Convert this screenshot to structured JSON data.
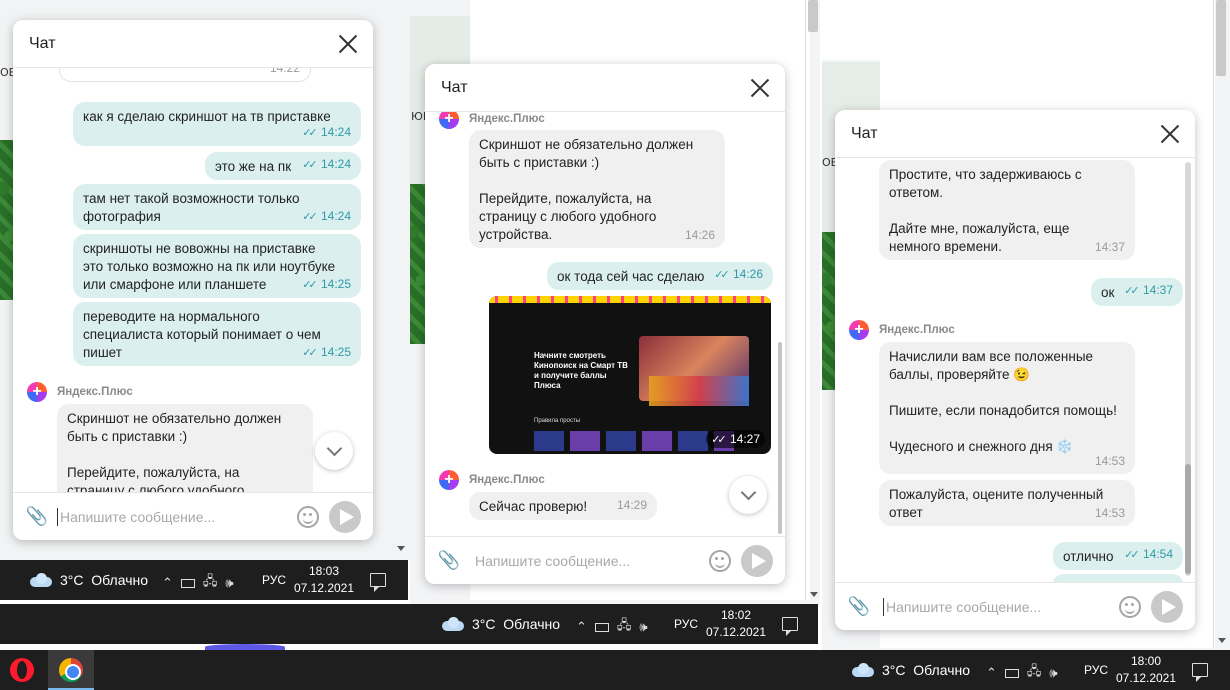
{
  "colors": {
    "outgoing_bubble": "#dcefef",
    "incoming_bubble": "#f0f0f0",
    "read_ticks": "#2c9aa7",
    "taskbar": "#1e1e1e"
  },
  "icons": {
    "close": "close-icon",
    "attach": "paperclip-icon",
    "emoji": "smiley-icon",
    "send": "send-icon",
    "scroll": "chevron-down-icon",
    "weather": "cloud-icon"
  },
  "common": {
    "chat_title": "Чат",
    "input_placeholder": "Напишите сообщение...",
    "sender_name": "Яндекс.Плюс",
    "read_mark": "✓✓"
  },
  "edge_fragments": {
    "left_a": "ОЕ",
    "mid_a": "ЮЕ",
    "right_a": "ОЕ"
  },
  "chat1": {
    "messages": [
      {
        "text": "",
        "time": "14:22"
      },
      {
        "text": "как я сделаю скриншот на тв приставке",
        "time": "14:24"
      },
      {
        "text": "это же на пк",
        "time": "14:24"
      },
      {
        "text": "там нет такой возможности только\nфотография",
        "time": "14:24"
      },
      {
        "text": "скриншоты не вовожны на приставке\nэто только возможно на пк или ноутбуке\nили смарфоне или планшете",
        "time": "14:25"
      },
      {
        "text": "переводите на нормального\nспециалиста который понимает о чем\nпишет",
        "time": "14:25"
      },
      {
        "text": "Скриншот не обязательно должен\nбыть с приставки :)\n\nПерейдите, пожалуйста, на\nстраницу с любого удобного"
      }
    ]
  },
  "chat2": {
    "messages": [
      {
        "text": "Скриншот не обязательно должен\nбыть с приставки :)\n\nПерейдите, пожалуйста, на\nстраницу с любого удобного\nустройства.",
        "time": "14:26"
      },
      {
        "text": "ок тода сей час сделаю",
        "time": "14:26"
      },
      {
        "time": "14:27"
      },
      {
        "text": "Сейчас проверю!",
        "time": "14:29"
      }
    ],
    "screenshot": {
      "headline": "Начните смотреть\nКинопоиск на Смарт ТВ\nи получите баллы\nПлюса",
      "section": "Правила просты"
    }
  },
  "chat3": {
    "messages": [
      {
        "text": "Простите, что задерживаюсь с\nответом.\n\nДайте мне, пожалуйста, еще\nнемного времени.",
        "time": "14:37"
      },
      {
        "text": "ок",
        "time": "14:37"
      },
      {
        "text": "Начислили вам все положенные\nбаллы, проверяйте 😉\n\nПишите, если понадобится помощь!\n\nЧудесного и снежного дня ❄️",
        "time": "14:53"
      },
      {
        "text": "Пожалуйста, оцените полученный\nответ",
        "time": "14:53"
      },
      {
        "text": "отлично",
        "time": "14:54"
      }
    ]
  },
  "taskbars": {
    "tb1": {
      "weather": "3°C  Облачно",
      "lang": "РУС",
      "time": "18:03",
      "date": "07.12.2021"
    },
    "tb2": {
      "weather": "3°C  Облачно",
      "lang": "РУС",
      "time": "18:02",
      "date": "07.12.2021"
    },
    "tb3": {
      "weather": "3°C  Облачно",
      "lang": "РУС",
      "time": "18:00",
      "date": "07.12.2021"
    }
  },
  "tray_glyphs": {
    "chevron_up": "⌃",
    "network": "🖧",
    "volume": "🕪"
  }
}
